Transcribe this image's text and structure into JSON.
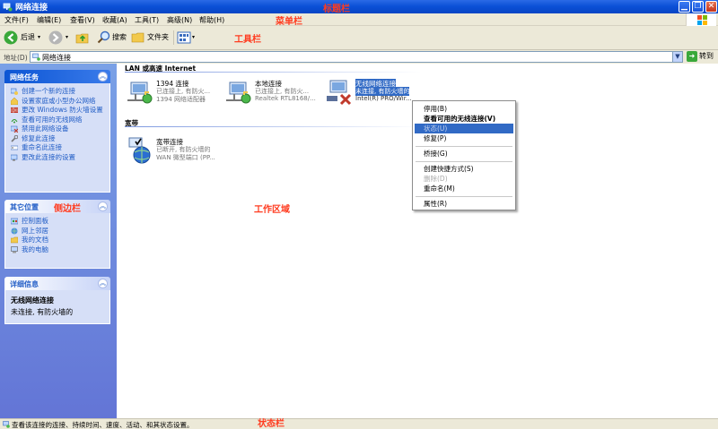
{
  "window": {
    "title": "网络连接",
    "title_anno": "标题栏"
  },
  "menubar": {
    "items": [
      "文件(F)",
      "编辑(E)",
      "查看(V)",
      "收藏(A)",
      "工具(T)",
      "高级(N)",
      "帮助(H)"
    ],
    "anno": "菜单栏"
  },
  "toolbar": {
    "back": "后退",
    "search": "搜索",
    "folders": "文件夹",
    "anno": "工具栏"
  },
  "address": {
    "label": "地址(D)",
    "value": "网络连接",
    "go": "转到"
  },
  "sidebar": {
    "anno": "侧边栏",
    "tasks": {
      "title": "网络任务",
      "items": [
        "创建一个新的连接",
        "设置家庭或小型办公网络",
        "更改 Windows 防火墙设置",
        "查看可用的无线网络",
        "禁用此网络设备",
        "修复此连接",
        "重命名此连接",
        "更改此连接的设置"
      ]
    },
    "places": {
      "title": "其它位置",
      "items": [
        "控制面板",
        "网上邻居",
        "我的文档",
        "我的电脑"
      ]
    },
    "details": {
      "title": "详细信息",
      "name": "无线网络连接",
      "status": "未连接, 有防火墙的"
    }
  },
  "work": {
    "anno": "工作区域",
    "groups": {
      "lan": "LAN 或高速 Internet",
      "broadband": "宽带"
    },
    "connections": [
      {
        "name": "1394 连接",
        "status": "已连接上, 有防火...",
        "device": "1394 网络适配器"
      },
      {
        "name": "本地连接",
        "status": "已连接上, 有防火...",
        "device": "Realtek RTL8168/..."
      },
      {
        "name": "无线网络连接",
        "status": "未连接, 有防火墙的",
        "device": "Intel(R) PRO/Wir..."
      },
      {
        "name": "宽带连接",
        "status": "已断开, 有防火墙的",
        "device": "WAN 微型端口 (PP..."
      }
    ]
  },
  "context_menu": {
    "items": [
      "停用(B)",
      "查看可用的无线连接(V)",
      "状态(U)",
      "修复(P)",
      "桥接(G)",
      "创建快捷方式(S)",
      "删除(D)",
      "重命名(M)",
      "属性(R)"
    ]
  },
  "statusbar": {
    "text": "查看该连接的连接、持续时间、速度、活动、和其状态设置。",
    "anno": "状态栏"
  },
  "colors": {
    "annotation": "#ff3b1f",
    "title_blue": "#0a4fd6",
    "sidebar_blue": "#6375d6",
    "selection": "#316ac5"
  }
}
